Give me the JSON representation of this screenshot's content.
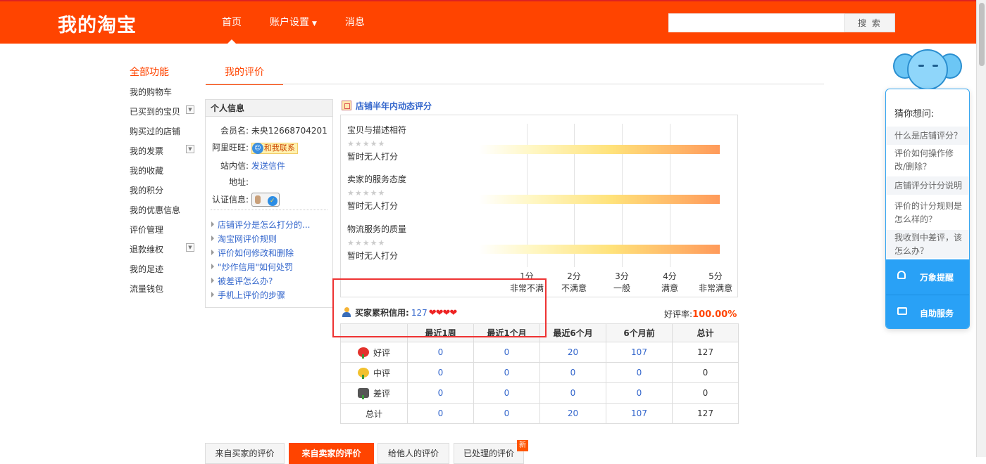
{
  "header": {
    "logo": "我的淘宝",
    "nav": [
      {
        "label": "首页"
      },
      {
        "label": "账户设置"
      },
      {
        "label": "消息"
      }
    ],
    "search_button": "搜 索",
    "search_value": ""
  },
  "sidebar": {
    "title": "全部功能",
    "items": [
      {
        "label": "我的购物车"
      },
      {
        "label": "已买到的宝贝"
      },
      {
        "label": "购买过的店铺"
      },
      {
        "label": "我的发票"
      },
      {
        "label": "我的收藏"
      },
      {
        "label": "我的积分"
      },
      {
        "label": "我的优惠信息"
      },
      {
        "label": "评价管理"
      },
      {
        "label": "退款维权"
      },
      {
        "label": "我的足迹"
      },
      {
        "label": "流量钱包"
      }
    ]
  },
  "main": {
    "tab": "我的评价"
  },
  "profile": {
    "title": "个人信息",
    "member_label": "会员名:",
    "member_value": "未央12668704201",
    "wangwang_label": "阿里旺旺:",
    "wangwang_button": "和我联系",
    "message_label": "站内信:",
    "message_link": "发送信件",
    "address_label": "地址:",
    "cert_label": "认证信息:",
    "help_links": [
      {
        "label": "店铺评分是怎么打分的..."
      },
      {
        "label": "淘宝网评价规则"
      },
      {
        "label": "评价如何修改和删除"
      },
      {
        "label": "\"炒作信用\"如何处罚"
      },
      {
        "label": "被差评怎么办?"
      },
      {
        "label": "手机上评价的步骤"
      }
    ]
  },
  "ratings": {
    "title": "店铺半年内动态评分",
    "metrics": [
      {
        "title": "宝贝与描述相符",
        "stars": "★★★★★",
        "empty": "暂时无人打分"
      },
      {
        "title": "卖家的服务态度",
        "stars": "★★★★★",
        "empty": "暂时无人打分"
      },
      {
        "title": "物流服务的质量",
        "stars": "★★★★★",
        "empty": "暂时无人打分"
      }
    ],
    "scale": [
      {
        "score": "1分",
        "label": "非常不满"
      },
      {
        "score": "2分",
        "label": "不满意"
      },
      {
        "score": "3分",
        "label": "一般"
      },
      {
        "score": "4分",
        "label": "满意"
      },
      {
        "score": "5分",
        "label": "非常满意"
      }
    ]
  },
  "credit": {
    "label": "买家累积信用:",
    "count": "127",
    "hearts": "❤❤❤❤",
    "good_rate_label": "好评率:",
    "good_rate_value": "100.00%"
  },
  "stats": {
    "headers": [
      "",
      "最近1周",
      "最近1个月",
      "最近6个月",
      "6个月前",
      "总计"
    ],
    "rows": [
      {
        "label": "好评",
        "icon": "good",
        "values": [
          "0",
          "0",
          "20",
          "107",
          "127"
        ]
      },
      {
        "label": "中评",
        "icon": "mid",
        "values": [
          "0",
          "0",
          "0",
          "0",
          "0"
        ]
      },
      {
        "label": "差评",
        "icon": "bad",
        "values": [
          "0",
          "0",
          "0",
          "0",
          "0"
        ]
      },
      {
        "label": "总计",
        "icon": "",
        "values": [
          "0",
          "0",
          "20",
          "107",
          "127"
        ]
      }
    ]
  },
  "bottom_tabs": [
    {
      "label": "来自买家的评价"
    },
    {
      "label": "来自卖家的评价"
    },
    {
      "label": "给他人的评价"
    },
    {
      "label": "已处理的评价"
    }
  ],
  "new_badge": "新",
  "assistant": {
    "title": "猜你想问:",
    "questions": [
      {
        "label": "什么是店铺评分？"
      },
      {
        "label": "评价如何操作修改/删除？"
      },
      {
        "label": "店铺评分计分说明"
      },
      {
        "label": "评价的计分规则是怎么样的？"
      },
      {
        "label": "我收到中差评，该怎么办？"
      }
    ],
    "remind_button": "万象提醒",
    "service_button": "自助服务"
  },
  "colors": {
    "brand": "#ff4400",
    "link": "#3366cc",
    "assistant": "#29a1f6",
    "highlight": "#e33333"
  }
}
